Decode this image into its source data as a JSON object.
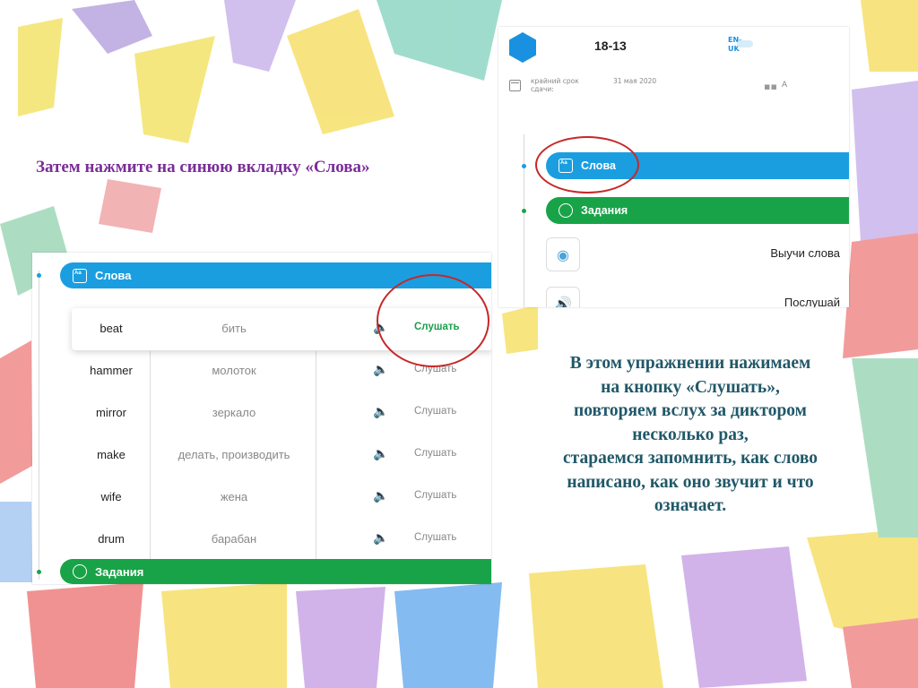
{
  "instructions": {
    "top": "Затем нажмите на синюю вкладку «Слова»",
    "right_lines": [
      "В этом упражнении нажимаем",
      "на кнопку «Слушать»,",
      "повторяем вслух за диктором",
      "несколько раз,",
      "стараемся запомнить, как слово",
      "написано, как оно звучит и что",
      "означает."
    ]
  },
  "assignment": {
    "code": "18-13",
    "lang_line1": "EN-",
    "lang_line2": "UK",
    "deadline_label": "крайний срок сдачи:",
    "deadline_date": "31 мая 2020",
    "group": "A",
    "tabs": {
      "words": "Слова",
      "tasks": "Задания"
    },
    "tasks": [
      {
        "label": "Выучи слова",
        "icon": "learn-words-icon"
      },
      {
        "label": "Послушай",
        "icon": "listen-icon"
      }
    ]
  },
  "words_panel": {
    "tab_words": "Слова",
    "tab_tasks": "Задания",
    "listen_label": "Слушать",
    "rows": [
      {
        "en": "beat",
        "ru": "бить"
      },
      {
        "en": "hammer",
        "ru": "молоток"
      },
      {
        "en": "mirror",
        "ru": "зеркало"
      },
      {
        "en": "make",
        "ru": "делать, производить"
      },
      {
        "en": "wife",
        "ru": "жена"
      },
      {
        "en": "drum",
        "ru": "барабан"
      }
    ]
  },
  "colors": {
    "blue_tab": "#1a9ee0",
    "green_tab": "#19a348",
    "highlight_circle": "#c62828",
    "top_caption": "#7a2d98",
    "right_caption": "#215868"
  }
}
